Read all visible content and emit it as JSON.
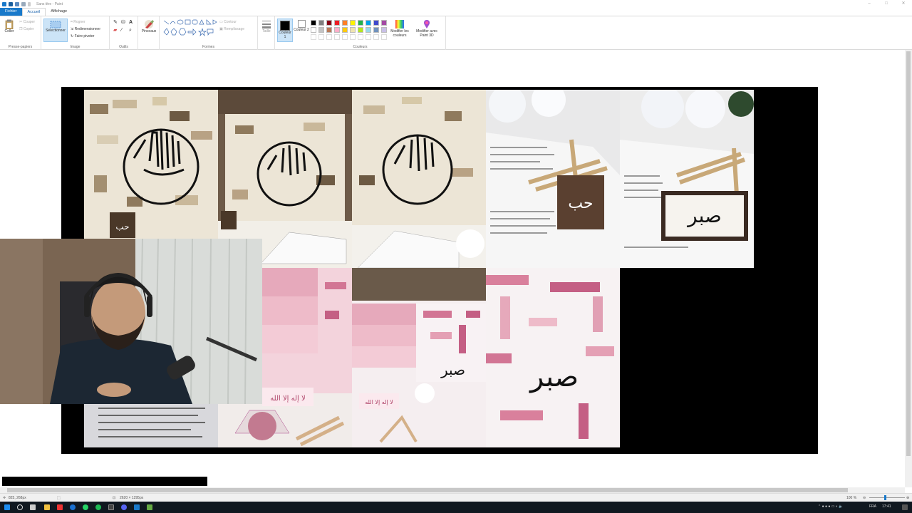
{
  "window": {
    "title": "Sans titre - Paint",
    "controls": [
      "–",
      "□",
      "✕"
    ]
  },
  "tabs": [
    "Fichier",
    "Accueil",
    "Affichage"
  ],
  "ribbon": {
    "clipboard": {
      "label": "Presse-papiers",
      "paste": "Coller",
      "cut": "Couper",
      "copy": "Copier"
    },
    "image": {
      "label": "Image",
      "select": "Sélectionner",
      "crop": "Rogner",
      "resize": "Redimensionner",
      "rotate": "Faire pivoter"
    },
    "tools": {
      "label": "Outils",
      "brushes": "Pinceaux"
    },
    "shapes": {
      "label": "Formes",
      "outline": "Contour",
      "fill": "Remplissage"
    },
    "size": "Taille",
    "colors": {
      "label": "Couleurs",
      "color1": "Couleur 1",
      "color2": "Couleur 2",
      "edit": "Modifier les couleurs",
      "paint3d": "Modifier avec Paint 3D"
    },
    "palette": [
      "#000000",
      "#7f7f7f",
      "#880015",
      "#ed1c24",
      "#ff7f27",
      "#fff200",
      "#22b14c",
      "#00a2e8",
      "#3f48cc",
      "#a349a4",
      "#ffffff",
      "#c3c3c3",
      "#b97a57",
      "#ffaec9",
      "#ffc90e",
      "#efe4b0",
      "#b5e61d",
      "#99d9ea",
      "#7092be",
      "#c8bfe7"
    ]
  },
  "status": {
    "cursor": "825, 268px",
    "image_size": "2620 × 1295px",
    "zoom": "100 %"
  },
  "taskbar": {
    "language": "FRA",
    "time": "17:41"
  },
  "artwork": {
    "word_hubb": "حب",
    "word_sabr": "صبر",
    "word_shahada": "لا إله إلا الله"
  }
}
